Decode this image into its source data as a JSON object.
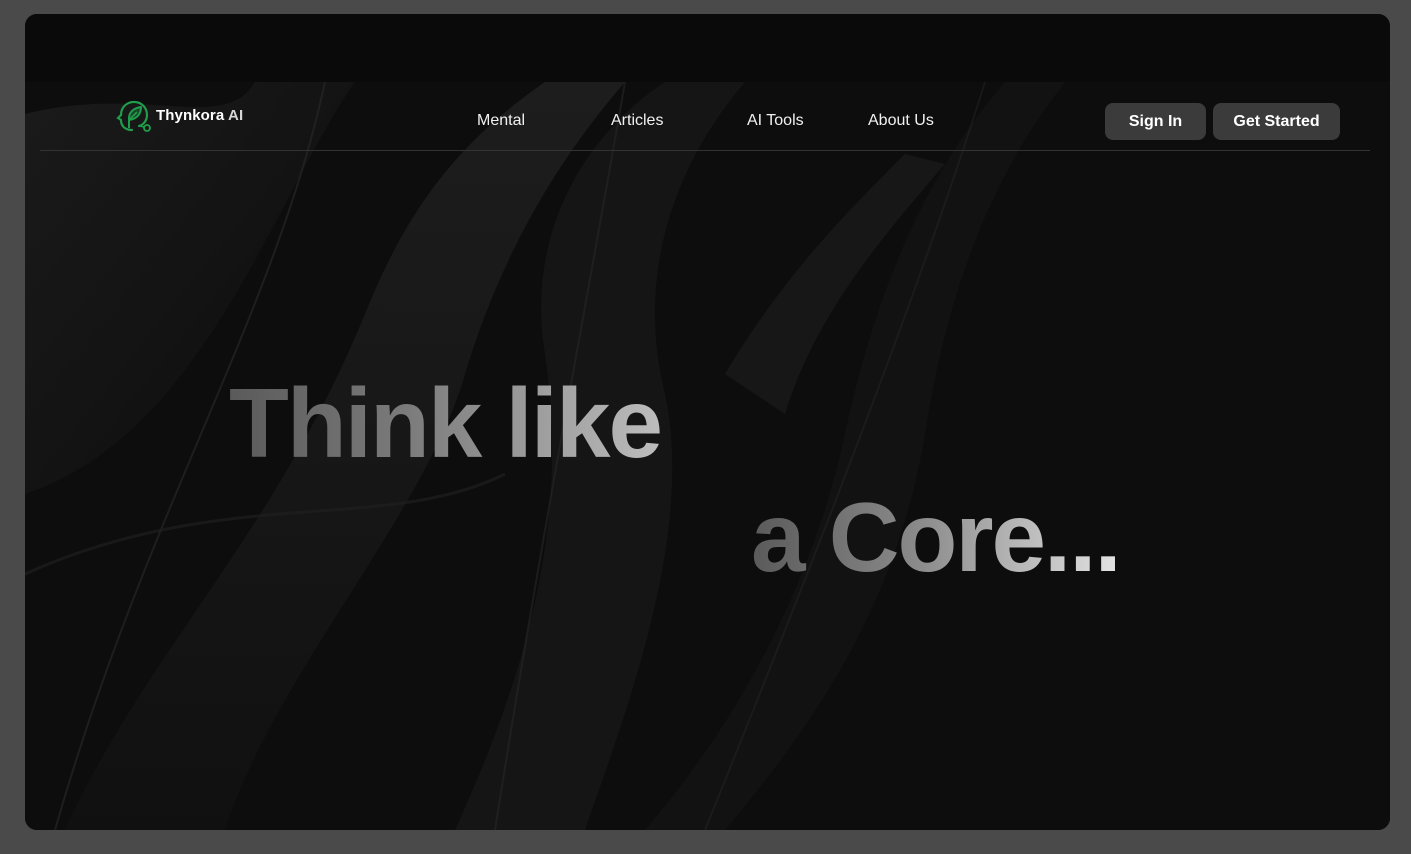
{
  "brand": {
    "name_main": "Thynkora",
    "name_suffix": " AI",
    "icon": "head-leaf-icon",
    "accent_color": "#1f9d4a"
  },
  "nav": {
    "links": [
      {
        "label": "Mental"
      },
      {
        "label": "Articles"
      },
      {
        "label": "AI Tools"
      },
      {
        "label": "About Us"
      }
    ]
  },
  "actions": {
    "sign_in": "Sign In",
    "get_started": "Get Started"
  },
  "hero": {
    "line1": "Think like",
    "line2": "a Core..."
  },
  "colors": {
    "page_bg": "#0a0a0a",
    "button_bg": "#3b3b3b",
    "outer_frame": "#4a4a4a"
  }
}
